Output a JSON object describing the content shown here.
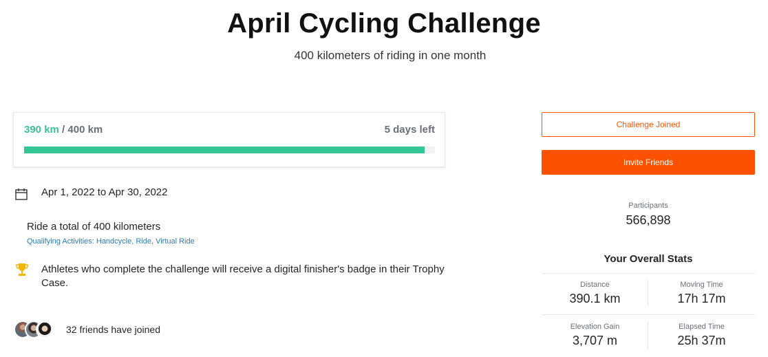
{
  "header": {
    "title": "April Cycling Challenge",
    "subtitle": "400 kilometers of riding in one month"
  },
  "progress": {
    "current": "390 km",
    "separator": " / ",
    "goal": "400 km",
    "days_left": "5 days left",
    "fraction": 0.975,
    "fill_color": "#34c796"
  },
  "details": {
    "date_range": "Apr 1, 2022 to Apr 30, 2022",
    "goal_text": "Ride a total of 400 kilometers",
    "qualifying": "Qualifying Activities: Handcycle, Ride, Virtual Ride",
    "badge_text": "Athletes who complete the challenge will receive a digital finisher's badge in their Trophy Case."
  },
  "friends": {
    "text": "32 friends have joined"
  },
  "actions": {
    "joined_label": "Challenge Joined",
    "invite_label": "Invite Friends",
    "accent_color": "#fc5200"
  },
  "participants": {
    "label": "Participants",
    "value": "566,898"
  },
  "stats": {
    "title": "Your Overall Stats",
    "distance_label": "Distance",
    "distance_value": "390.1 km",
    "moving_label": "Moving Time",
    "moving_value": "17h 17m",
    "elevation_label": "Elevation Gain",
    "elevation_value": "3,707 m",
    "elapsed_label": "Elapsed Time",
    "elapsed_value": "25h 37m"
  }
}
